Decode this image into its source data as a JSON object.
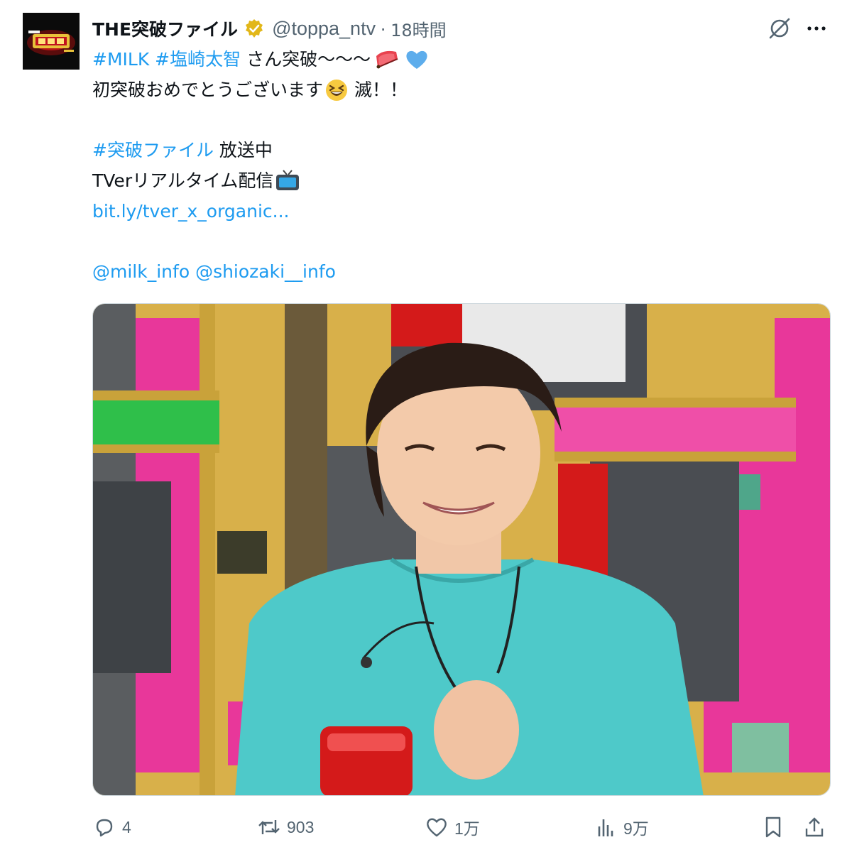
{
  "account": {
    "display_name": "THE突破ファイル",
    "handle": "@toppa_ntv",
    "separator": "·",
    "timestamp": "18時間",
    "avatar_logo_text": "THE突破ファイル",
    "verified_badge_color": "#e2b719"
  },
  "tweet": {
    "line1": {
      "hashtag1": "#MILK",
      "hashtag2": "#塩崎太智",
      "text": "さん突破〜〜〜"
    },
    "line2": {
      "text": "初突破おめでとうございます",
      "after_emoji": "滅！！"
    },
    "line3": {
      "hashtag": "#突破ファイル",
      "text": "放送中"
    },
    "line4": {
      "text": "TVerリアルタイム配信"
    },
    "line5": {
      "link": "bit.ly/tver_x_organic..."
    },
    "line6": {
      "mention1": "@milk_info",
      "mention2": "@shiozaki__info"
    }
  },
  "icons": {
    "line1_emojis": [
      "folding-fan-icon",
      "blue-heart-icon"
    ],
    "line2_emoji": "grinning-squinting-face-icon",
    "line4_emoji": "television-icon",
    "top_right": [
      "grok-icon",
      "more-options-icon"
    ]
  },
  "metrics": {
    "replies": "4",
    "reposts": "903",
    "likes": "1万",
    "views": "9万"
  },
  "colors": {
    "link": "#1d9bf0",
    "secondary_text": "#536471",
    "primary_text": "#0f1419",
    "shirt": "#4ec9c9",
    "set_pink": "#e8379a",
    "set_gold": "#c9a23a"
  }
}
